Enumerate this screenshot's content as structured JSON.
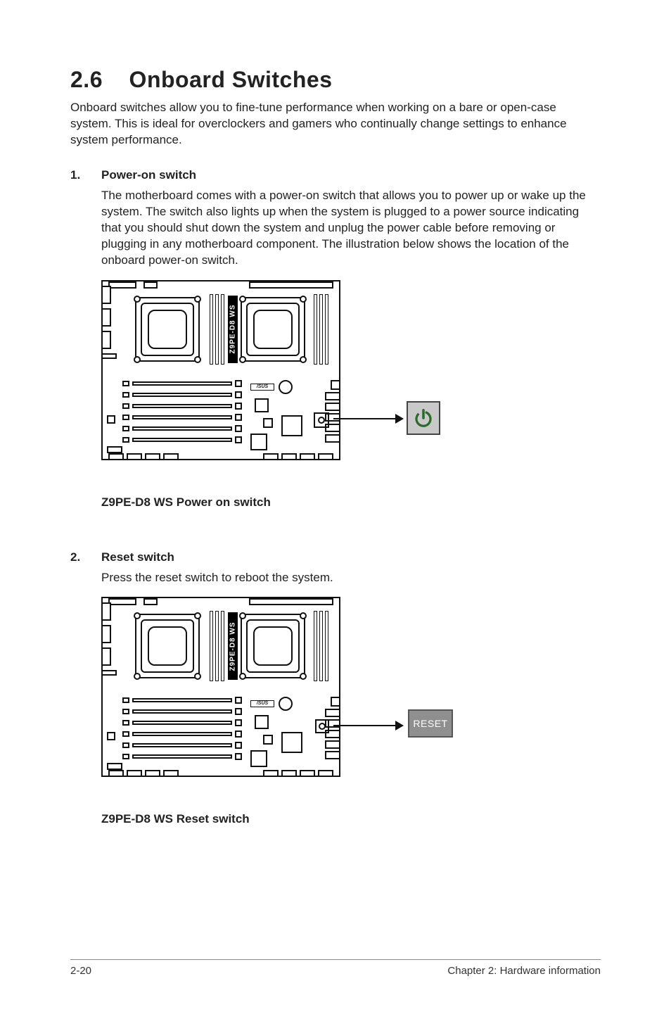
{
  "heading": {
    "number": "2.6",
    "title": "Onboard Switches"
  },
  "intro": "Onboard switches allow you to fine-tune performance when working on a bare or open-case system. This is ideal for overclockers and gamers who continually change settings to enhance system performance.",
  "items": [
    {
      "num": "1.",
      "title": "Power-on switch",
      "body": "The motherboard comes with a power-on switch that allows you to power up or wake up the system. The switch also lights up when the system is plugged to a power source indicating that you should shut down the system and unplug the power cable before removing or plugging in any motherboard component. The illustration below shows the location of the onboard power-on switch.",
      "figure_label": "Z9PE-D8 WS",
      "caption": "Z9PE-D8 WS Power on switch",
      "callout": "power-icon"
    },
    {
      "num": "2.",
      "title": "Reset switch",
      "body": "Press the reset switch to reboot the system.",
      "figure_label": "Z9PE-D8 WS",
      "caption": "Z9PE-D8 WS Reset switch",
      "callout": "RESET"
    }
  ],
  "board_logo": "/SUS",
  "footer": {
    "left": "2-20",
    "right": "Chapter 2: Hardware information"
  }
}
